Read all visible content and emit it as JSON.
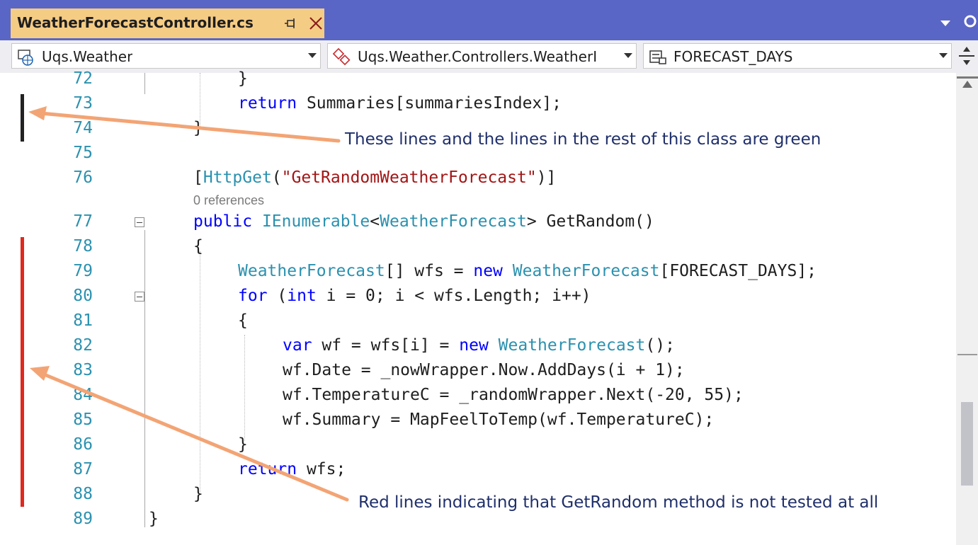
{
  "tab": {
    "title": "WeatherForecastController.cs",
    "pin_icon": "pin-icon",
    "close_icon": "close-icon"
  },
  "navbar": {
    "project": "Uqs.Weather",
    "type": "Uqs.Weather.Controllers.WeatherI",
    "member": "FORECAST_DAYS"
  },
  "editor": {
    "references_label": "0 references",
    "lines": [
      {
        "num": "72",
        "code": "}"
      },
      {
        "num": "73",
        "code": "return Summaries[summariesIndex];"
      },
      {
        "num": "74",
        "code": "}"
      },
      {
        "num": "75",
        "code": ""
      },
      {
        "num": "76",
        "code": "[HttpGet(\"GetRandomWeatherForecast\")]"
      },
      {
        "num": "77",
        "code": "public IEnumerable<WeatherForecast> GetRandom()"
      },
      {
        "num": "78",
        "code": "{"
      },
      {
        "num": "79",
        "code": "WeatherForecast[] wfs = new WeatherForecast[FORECAST_DAYS];"
      },
      {
        "num": "80",
        "code": "for (int i = 0; i < wfs.Length; i++)"
      },
      {
        "num": "81",
        "code": "{"
      },
      {
        "num": "82",
        "code": "var wf = wfs[i] = new WeatherForecast();"
      },
      {
        "num": "83",
        "code": "wf.Date = _nowWrapper.Now.AddDays(i + 1);"
      },
      {
        "num": "84",
        "code": "wf.TemperatureC = _randomWrapper.Next(-20, 55);"
      },
      {
        "num": "85",
        "code": "wf.Summary = MapFeelToTemp(wf.TemperatureC);"
      },
      {
        "num": "86",
        "code": "}"
      },
      {
        "num": "87",
        "code": "return wfs;"
      },
      {
        "num": "88",
        "code": "}"
      },
      {
        "num": "89",
        "code": "}"
      }
    ]
  },
  "annotations": {
    "green_note": "These lines and the lines in the rest of this class are green",
    "red_note": "Red lines indicating that GetRandom method is not tested at all"
  },
  "colors": {
    "tab_strip": "#5a66c6",
    "active_tab": "#f5cc84",
    "coverage_covered_bar": "#222222",
    "coverage_uncovered_bar": "#e0281e",
    "arrow": "#f0a070",
    "annotation_text": "#1f2f6b"
  }
}
